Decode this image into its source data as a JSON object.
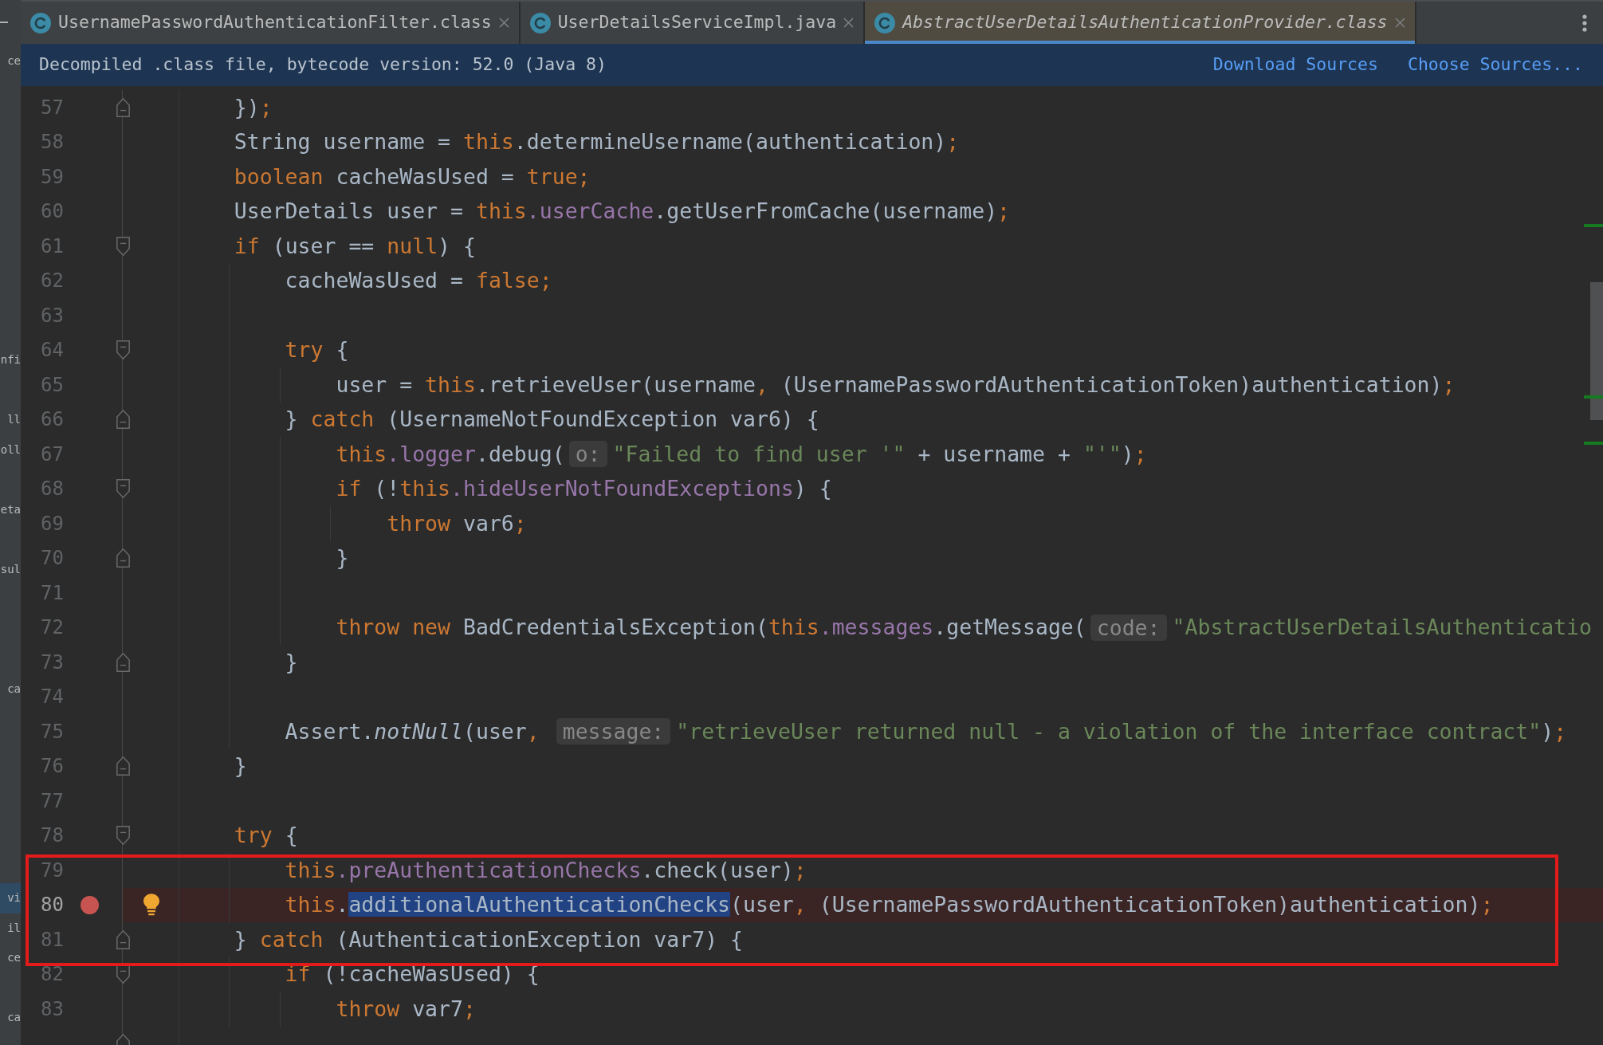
{
  "project_panel": {
    "items": [
      {
        "text": "ce",
        "selected": false
      },
      {
        "text": "nfi",
        "selected": false
      },
      {
        "text": "ll",
        "selected": false
      },
      {
        "text": "oll",
        "selected": false
      },
      {
        "text": "eta",
        "selected": false
      },
      {
        "text": "sul",
        "selected": false
      },
      {
        "text": "ca",
        "selected": false
      },
      {
        "text": "vi",
        "selected": true
      },
      {
        "text": "il",
        "selected": false
      },
      {
        "text": "ce",
        "selected": false
      },
      {
        "text": "ca",
        "selected": false
      }
    ]
  },
  "tabs": [
    {
      "label": "UsernamePasswordAuthenticationFilter.class",
      "selected": false,
      "preview": false
    },
    {
      "label": "UserDetailsServiceImpl.java",
      "selected": false,
      "preview": false
    },
    {
      "label": "AbstractUserDetailsAuthenticationProvider.class",
      "selected": true,
      "preview": true
    }
  ],
  "notice": {
    "text": "Decompiled .class file, bytecode version: 52.0 (Java 8)",
    "links": [
      "Download Sources",
      "Choose Sources..."
    ]
  },
  "lines": [
    {
      "number": "57",
      "breakpoint": false,
      "current": false,
      "boxed": false,
      "fold": {
        "kind": "end"
      },
      "segments": [
        {
          "kind": "code",
          "tokens": [
            {
              "kind": "plain",
              "text": "    })"
            },
            {
              "kind": "keyword",
              "text": ";"
            }
          ]
        }
      ]
    },
    {
      "number": "58",
      "breakpoint": false,
      "current": false,
      "boxed": false,
      "segments": [
        {
          "kind": "code",
          "tokens": [
            {
              "kind": "plain",
              "text": "    String username = "
            },
            {
              "kind": "keyword",
              "text": "this"
            },
            {
              "kind": "plain",
              "text": ".determineUsername(authentication)"
            },
            {
              "kind": "keyword",
              "text": ";"
            }
          ]
        }
      ]
    },
    {
      "number": "59",
      "breakpoint": false,
      "current": false,
      "boxed": false,
      "segments": [
        {
          "kind": "code",
          "tokens": [
            {
              "kind": "keyword",
              "text": "    boolean"
            },
            {
              "kind": "plain",
              "text": " cacheWasUsed = "
            },
            {
              "kind": "keyword",
              "text": "true;"
            }
          ]
        }
      ]
    },
    {
      "number": "60",
      "breakpoint": false,
      "current": false,
      "boxed": false,
      "segments": [
        {
          "kind": "code",
          "tokens": [
            {
              "kind": "plain",
              "text": "    UserDetails user = "
            },
            {
              "kind": "keyword",
              "text": "this"
            },
            {
              "kind": "field",
              "text": ".userCache"
            },
            {
              "kind": "plain",
              "text": ".getUserFromCache(username)"
            },
            {
              "kind": "keyword",
              "text": ";"
            }
          ]
        }
      ]
    },
    {
      "number": "61",
      "breakpoint": false,
      "current": false,
      "boxed": false,
      "fold": {
        "kind": "start"
      },
      "segments": [
        {
          "kind": "code",
          "tokens": [
            {
              "kind": "keyword",
              "text": "    if"
            },
            {
              "kind": "plain",
              "text": " (user == "
            },
            {
              "kind": "keyword",
              "text": "null"
            },
            {
              "kind": "plain",
              "text": ") {"
            }
          ]
        }
      ]
    },
    {
      "number": "62",
      "breakpoint": false,
      "current": false,
      "boxed": false,
      "segments": [
        {
          "kind": "code",
          "tokens": [
            {
              "kind": "plain",
              "text": "        cacheWasUsed = "
            },
            {
              "kind": "keyword",
              "text": "false;"
            }
          ]
        }
      ]
    },
    {
      "number": "63",
      "breakpoint": false,
      "current": false,
      "boxed": false
    },
    {
      "number": "64",
      "breakpoint": false,
      "current": false,
      "boxed": false,
      "fold": {
        "kind": "start"
      },
      "segments": [
        {
          "kind": "code",
          "tokens": [
            {
              "kind": "keyword",
              "text": "        try"
            },
            {
              "kind": "plain",
              "text": " {"
            }
          ]
        }
      ]
    },
    {
      "number": "65",
      "breakpoint": false,
      "current": false,
      "boxed": false,
      "segments": [
        {
          "kind": "code",
          "tokens": [
            {
              "kind": "plain",
              "text": "            user = "
            },
            {
              "kind": "keyword",
              "text": "this"
            },
            {
              "kind": "plain",
              "text": ".retrieveUser(username"
            },
            {
              "kind": "keyword",
              "text": ","
            },
            {
              "kind": "plain",
              "text": " (UsernamePasswordAuthenticationToken)authentication)"
            },
            {
              "kind": "keyword",
              "text": ";"
            }
          ]
        }
      ]
    },
    {
      "number": "66",
      "breakpoint": false,
      "current": false,
      "boxed": false,
      "fold": {
        "kind": "end"
      },
      "segments": [
        {
          "kind": "code",
          "tokens": [
            {
              "kind": "plain",
              "text": "        } "
            },
            {
              "kind": "keyword",
              "text": "catch"
            },
            {
              "kind": "plain",
              "text": " (UsernameNotFoundException var6) {"
            }
          ]
        }
      ]
    },
    {
      "number": "67",
      "breakpoint": false,
      "current": false,
      "boxed": false,
      "segments": [
        {
          "kind": "code",
          "tokens": [
            {
              "kind": "keyword",
              "text": "            this"
            },
            {
              "kind": "field",
              "text": ".logger"
            },
            {
              "kind": "plain",
              "text": ".debug("
            }
          ]
        },
        {
          "kind": "hint",
          "text": "o:"
        },
        {
          "kind": "code",
          "tokens": [
            {
              "kind": "string",
              "text": "\"Failed to find user '\""
            },
            {
              "kind": "plain",
              "text": " + username + "
            },
            {
              "kind": "string",
              "text": "\"'\""
            },
            {
              "kind": "plain",
              "text": ")"
            },
            {
              "kind": "keyword",
              "text": ";"
            }
          ]
        }
      ]
    },
    {
      "number": "68",
      "breakpoint": false,
      "current": false,
      "boxed": false,
      "fold": {
        "kind": "start"
      },
      "segments": [
        {
          "kind": "code",
          "tokens": [
            {
              "kind": "keyword",
              "text": "            if"
            },
            {
              "kind": "plain",
              "text": " (!"
            },
            {
              "kind": "keyword",
              "text": "this"
            },
            {
              "kind": "field",
              "text": ".hideUserNotFoundExceptions"
            },
            {
              "kind": "plain",
              "text": ") {"
            }
          ]
        }
      ]
    },
    {
      "number": "69",
      "breakpoint": false,
      "current": false,
      "boxed": false,
      "segments": [
        {
          "kind": "code",
          "tokens": [
            {
              "kind": "keyword",
              "text": "                throw"
            },
            {
              "kind": "plain",
              "text": " var6"
            },
            {
              "kind": "keyword",
              "text": ";"
            }
          ]
        }
      ]
    },
    {
      "number": "70",
      "breakpoint": false,
      "current": false,
      "boxed": false,
      "fold": {
        "kind": "end"
      },
      "segments": [
        {
          "kind": "code",
          "tokens": [
            {
              "kind": "plain",
              "text": "            }"
            }
          ]
        }
      ]
    },
    {
      "number": "71",
      "breakpoint": false,
      "current": false,
      "boxed": false
    },
    {
      "number": "72",
      "breakpoint": false,
      "current": false,
      "boxed": false,
      "segments": [
        {
          "kind": "code",
          "tokens": [
            {
              "kind": "keyword",
              "text": "            throw new"
            },
            {
              "kind": "plain",
              "text": " BadCredentialsException("
            },
            {
              "kind": "keyword",
              "text": "this"
            },
            {
              "kind": "field",
              "text": ".messages"
            },
            {
              "kind": "plain",
              "text": ".getMessage("
            }
          ]
        },
        {
          "kind": "hint",
          "text": "code:"
        },
        {
          "kind": "code",
          "tokens": [
            {
              "kind": "string",
              "text": "\"AbstractUserDetailsAuthenticatio"
            }
          ]
        }
      ]
    },
    {
      "number": "73",
      "breakpoint": false,
      "current": false,
      "boxed": false,
      "fold": {
        "kind": "end"
      },
      "segments": [
        {
          "kind": "code",
          "tokens": [
            {
              "kind": "plain",
              "text": "        }"
            }
          ]
        }
      ]
    },
    {
      "number": "74",
      "breakpoint": false,
      "current": false,
      "boxed": false
    },
    {
      "number": "75",
      "breakpoint": false,
      "current": false,
      "boxed": false,
      "segments": [
        {
          "kind": "code",
          "tokens": [
            {
              "kind": "plain",
              "text": "        Assert."
            },
            {
              "kind": "static",
              "text": "notNull"
            },
            {
              "kind": "plain",
              "text": "(user"
            },
            {
              "kind": "keyword",
              "text": ", "
            }
          ]
        },
        {
          "kind": "hint",
          "text": "message:"
        },
        {
          "kind": "code",
          "tokens": [
            {
              "kind": "string",
              "text": "\"retrieveUser returned null - a violation of the interface contract\""
            },
            {
              "kind": "plain",
              "text": ")"
            },
            {
              "kind": "keyword",
              "text": ";"
            }
          ]
        }
      ]
    },
    {
      "number": "76",
      "breakpoint": false,
      "current": false,
      "boxed": false,
      "fold": {
        "kind": "end"
      },
      "segments": [
        {
          "kind": "code",
          "tokens": [
            {
              "kind": "plain",
              "text": "    }"
            }
          ]
        }
      ]
    },
    {
      "number": "77",
      "breakpoint": false,
      "current": false,
      "boxed": false
    },
    {
      "number": "78",
      "breakpoint": false,
      "current": false,
      "boxed": false,
      "fold": {
        "kind": "start"
      },
      "segments": [
        {
          "kind": "code",
          "tokens": [
            {
              "kind": "keyword",
              "text": "    try"
            },
            {
              "kind": "plain",
              "text": " {"
            }
          ]
        }
      ]
    },
    {
      "number": "79",
      "breakpoint": false,
      "current": false,
      "boxed": true,
      "segments": [
        {
          "kind": "code",
          "tokens": [
            {
              "kind": "keyword",
              "text": "        this"
            },
            {
              "kind": "field",
              "text": ".preAuthenticationChecks"
            },
            {
              "kind": "plain",
              "text": ".check(user)"
            },
            {
              "kind": "keyword",
              "text": ";"
            }
          ]
        }
      ]
    },
    {
      "number": "80",
      "breakpoint": true,
      "current": true,
      "boxed": true,
      "segments": [
        {
          "kind": "code",
          "tokens": [
            {
              "kind": "keyword",
              "text": "        this"
            },
            {
              "kind": "plain",
              "text": "."
            },
            {
              "kind": "selection",
              "text": "additionalAuthenticationChecks"
            },
            {
              "kind": "plain",
              "text": "(user"
            },
            {
              "kind": "keyword",
              "text": ","
            },
            {
              "kind": "plain",
              "text": " (UsernamePasswordAuthenticationToken)authentication)"
            },
            {
              "kind": "keyword",
              "text": ";"
            }
          ]
        }
      ]
    },
    {
      "number": "81",
      "breakpoint": false,
      "current": false,
      "boxed": true,
      "fold": {
        "kind": "end"
      },
      "segments": [
        {
          "kind": "code",
          "tokens": [
            {
              "kind": "plain",
              "text": "    } "
            },
            {
              "kind": "keyword",
              "text": "catch"
            },
            {
              "kind": "plain",
              "text": " (AuthenticationException var7) {"
            }
          ]
        }
      ]
    },
    {
      "number": "82",
      "breakpoint": false,
      "current": false,
      "boxed": false,
      "fold": {
        "kind": "start"
      },
      "segments": [
        {
          "kind": "code",
          "tokens": [
            {
              "kind": "keyword",
              "text": "        if"
            },
            {
              "kind": "plain",
              "text": " (!cacheWasUsed) {"
            }
          ]
        }
      ]
    },
    {
      "number": "83",
      "breakpoint": false,
      "current": false,
      "boxed": false,
      "segments": [
        {
          "kind": "code",
          "tokens": [
            {
              "kind": "keyword",
              "text": "            throw"
            },
            {
              "kind": "plain",
              "text": " var7"
            },
            {
              "kind": "keyword",
              "text": ";"
            }
          ]
        }
      ]
    },
    {
      "breakpoint": false,
      "current": false,
      "boxed": false,
      "fold": {
        "kind": "end"
      }
    }
  ]
}
